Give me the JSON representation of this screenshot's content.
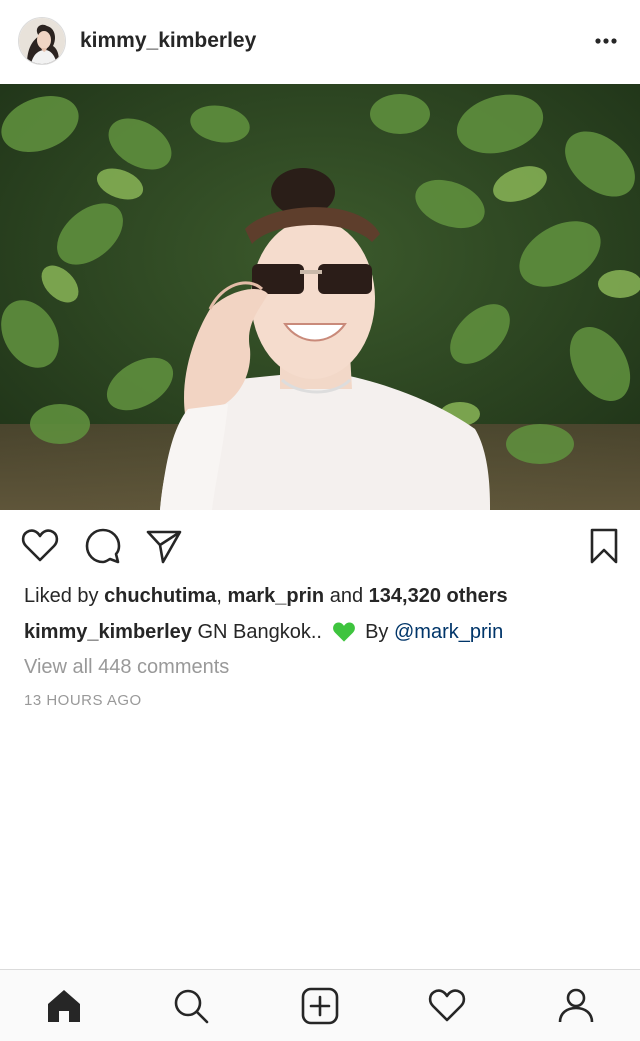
{
  "post": {
    "username": "kimmy_kimberley",
    "liked_by_prefix": "Liked by",
    "liked_user_1": "chuchutima",
    "liked_separator": ",",
    "liked_user_2": "mark_prin",
    "liked_and": "and",
    "liked_others": "134,320 others",
    "caption_author": "kimmy_kimberley",
    "caption_text": "GN Bangkok..",
    "caption_emoji": "green-heart",
    "caption_by": "By",
    "caption_mention": "@mark_prin",
    "view_comments": "View all 448 comments",
    "timestamp": "13 HOURS AGO"
  },
  "icons": {
    "more": "more-dots-icon",
    "like": "heart-outline-icon",
    "comment": "comment-bubble-icon",
    "share": "paper-plane-icon",
    "save": "bookmark-icon"
  },
  "tab_bar": [
    "home-icon",
    "search-icon",
    "new-post-icon",
    "activity-heart-icon",
    "profile-icon"
  ],
  "colors": {
    "text": "#262626",
    "muted": "#999999",
    "link": "#003569",
    "emoji": "#3ec43e"
  }
}
